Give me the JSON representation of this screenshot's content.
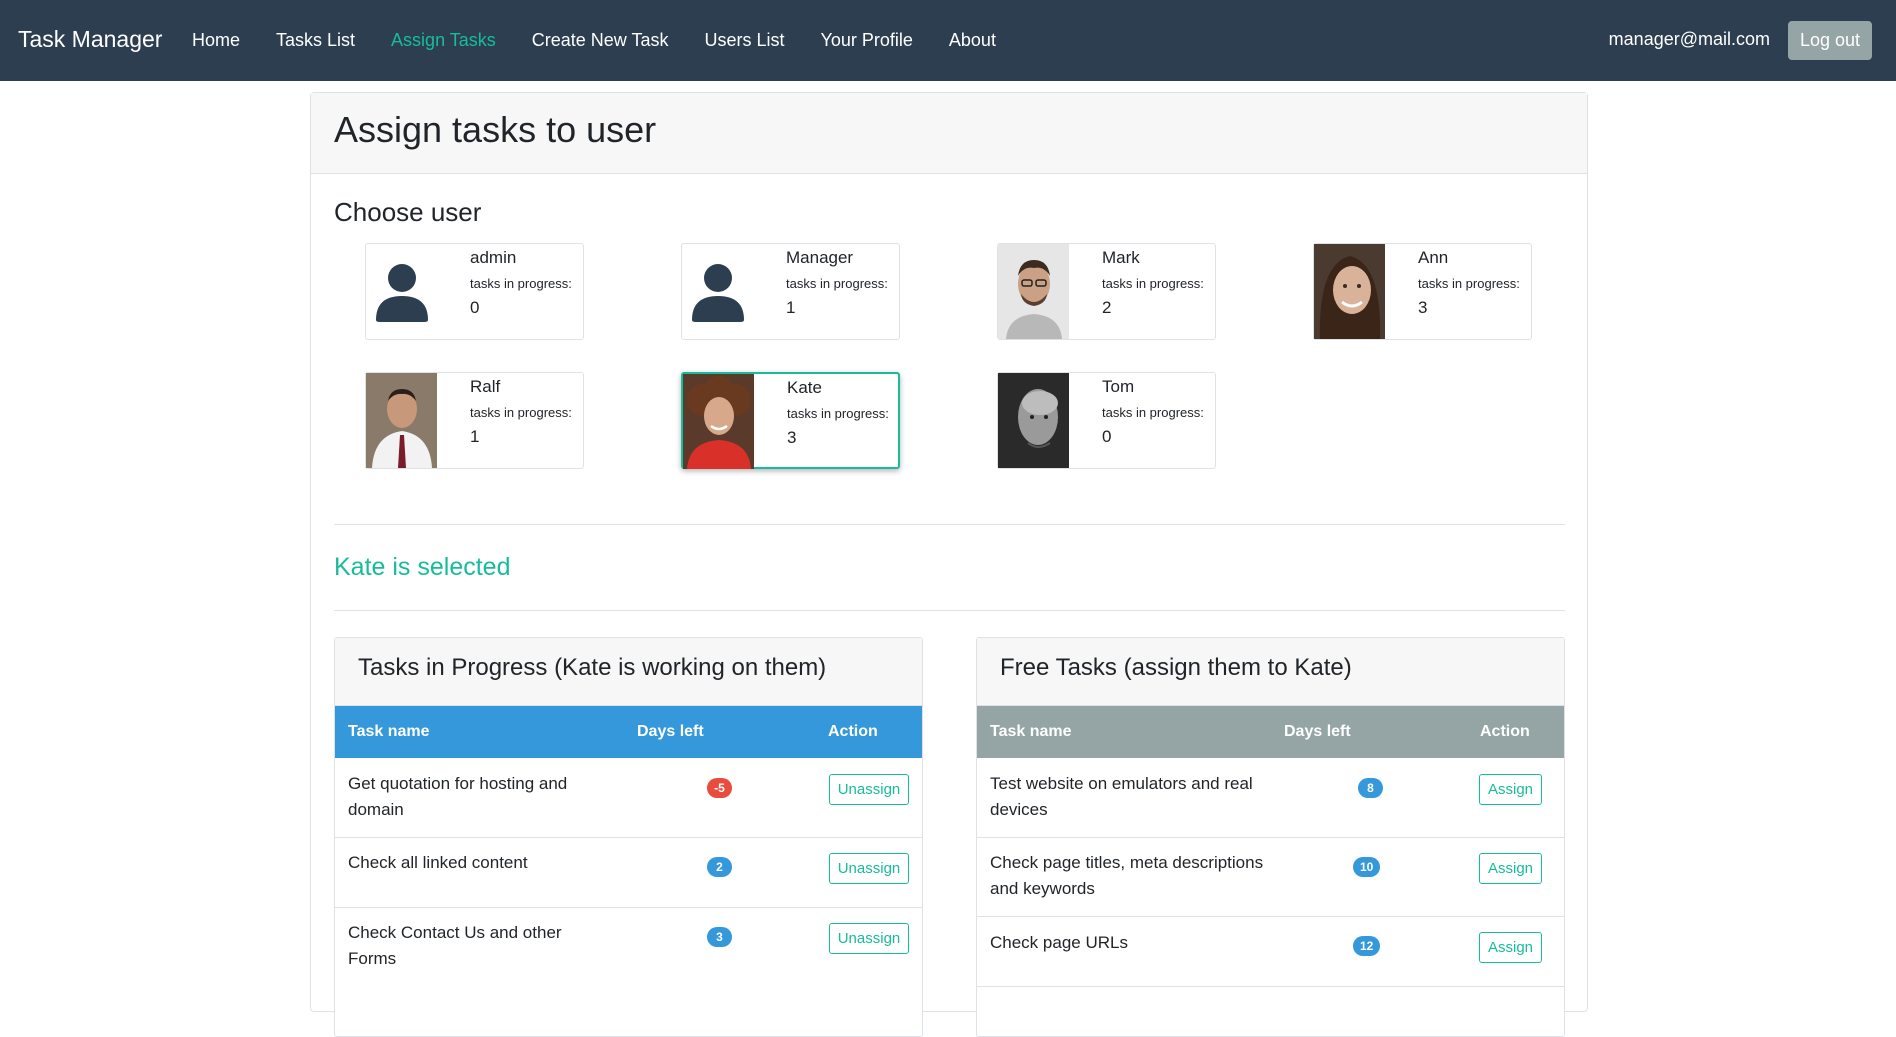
{
  "nav": {
    "brand": "Task Manager",
    "links": [
      "Home",
      "Tasks List",
      "Assign Tasks",
      "Create New Task",
      "Users List",
      "Your Profile",
      "About"
    ],
    "active_link": "Assign Tasks",
    "email": "manager@mail.com",
    "logout_label": "Log out"
  },
  "page": {
    "title": "Assign tasks to user",
    "choose_user_label": "Choose user",
    "tasks_in_progress_label": "tasks in progress:",
    "selected_text": "Kate is selected"
  },
  "users": [
    {
      "name": "admin",
      "tasks": "0",
      "photo": "default-avatar-icon"
    },
    {
      "name": "Manager",
      "tasks": "1",
      "photo": "default-avatar-icon"
    },
    {
      "name": "Mark",
      "tasks": "2",
      "photo": "photo"
    },
    {
      "name": "Ann",
      "tasks": "3",
      "photo": "photo"
    },
    {
      "name": "Ralf",
      "tasks": "1",
      "photo": "photo"
    },
    {
      "name": "Kate",
      "tasks": "3",
      "photo": "photo",
      "selected": true
    },
    {
      "name": "Tom",
      "tasks": "0",
      "photo": "photo"
    }
  ],
  "in_progress": {
    "title": "Tasks in Progress (Kate is working on them)",
    "headers": [
      "Task name",
      "Days left",
      "Action"
    ],
    "rows": [
      {
        "name": "Get quotation for hosting and domain",
        "days": "-5",
        "status": "overdue",
        "action": "Unassign"
      },
      {
        "name": "Check all linked content",
        "days": "2",
        "status": "ok",
        "action": "Unassign"
      },
      {
        "name": "Check Contact Us and other Forms",
        "days": "3",
        "status": "ok",
        "action": "Unassign"
      }
    ]
  },
  "free_tasks": {
    "title": "Free Tasks (assign them to Kate)",
    "headers": [
      "Task name",
      "Days left",
      "Action"
    ],
    "rows": [
      {
        "name": "Test website on emulators and real devices",
        "days": "8",
        "action": "Assign"
      },
      {
        "name": "Check page titles, meta descriptions and keywords",
        "days": "10",
        "action": "Assign"
      },
      {
        "name": "Check page URLs",
        "days": "12",
        "action": "Assign"
      }
    ]
  },
  "colors": {
    "navbar": "#2c3e50",
    "accent": "#18bc9c",
    "table_header_progress": "#3498db",
    "table_header_free": "#95a5a6",
    "badge_overdue": "#e74c3c",
    "badge_ok": "#3498db"
  }
}
